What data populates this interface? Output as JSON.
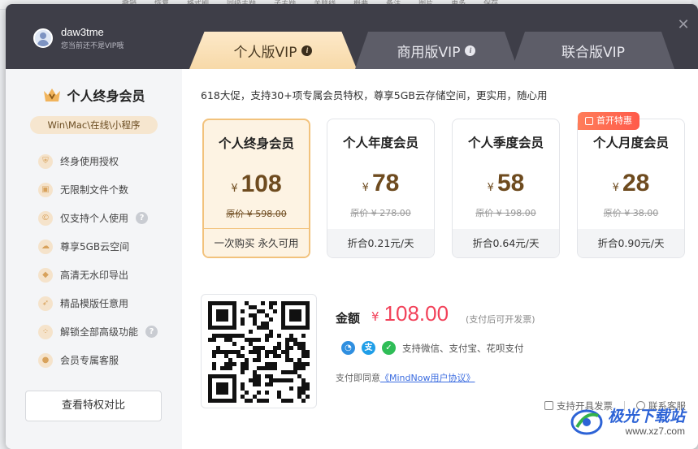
{
  "background": {
    "menu_items": [
      "撤销",
      "恢复",
      "格式刷",
      "同级主题",
      "子主题",
      "关联线",
      "概要",
      "备注",
      "图片",
      "更多",
      "保存"
    ]
  },
  "user": {
    "name": "daw3tme",
    "status": "您当前还不是VIP哦"
  },
  "tabs": [
    {
      "label": "个人版VIP"
    },
    {
      "label": "商用版VIP"
    },
    {
      "label": "联合版VIP"
    }
  ],
  "sidebar": {
    "title": "个人终身会员",
    "platforms": "Win\\Mac\\在线\\小程序",
    "features": [
      {
        "label": "终身使用授权",
        "icon": "shield-icon"
      },
      {
        "label": "无限制文件个数",
        "icon": "lock-icon"
      },
      {
        "label": "仅支持个人使用",
        "icon": "copyright-icon",
        "help": true
      },
      {
        "label": "尊享5GB云空间",
        "icon": "cloud-icon"
      },
      {
        "label": "高清无水印导出",
        "icon": "drop-icon"
      },
      {
        "label": "精品模版任意用",
        "icon": "rocket-icon"
      },
      {
        "label": "解锁全部高级功能",
        "icon": "grid-icon",
        "help": true
      },
      {
        "label": "会员专属客服",
        "icon": "user-icon"
      }
    ],
    "compare_button": "查看特权对比"
  },
  "promo": "618大促，支持30+项专属会员特权，尊享5GB云存储空间，更实用，随心用",
  "plans": [
    {
      "name": "个人终身会员",
      "currency": "¥",
      "price": "108",
      "original": "原价 ¥ 598.00",
      "footer": "一次购买 永久可用",
      "selected": true
    },
    {
      "name": "个人年度会员",
      "currency": "¥",
      "price": "78",
      "original": "原价 ¥ 278.00",
      "footer": "折合0.21元/天",
      "selected": false
    },
    {
      "name": "个人季度会员",
      "currency": "¥",
      "price": "58",
      "original": "原价 ¥ 198.00",
      "footer": "折合0.64元/天",
      "selected": false
    },
    {
      "name": "个人月度会员",
      "currency": "¥",
      "price": "28",
      "original": "原价 ¥ 38.00",
      "footer": "折合0.90元/天",
      "selected": false
    }
  ],
  "ribbon": "首开特惠",
  "payment": {
    "label": "金额",
    "currency": "¥",
    "amount": "108.00",
    "note": "(支付后可开发票)",
    "methods_text": "支持微信、支付宝、花呗支付",
    "agree_prefix": "支付即同意",
    "agree_link": "《MindNow用户协议》"
  },
  "footer": {
    "invoice": "支持开具发票",
    "service": "联系客服"
  },
  "watermark": {
    "name": "极光下载站",
    "url": "www.xz7.com"
  },
  "colors": {
    "accent": "#f2425a",
    "gold": "#f2c27c",
    "header": "#3e3e48",
    "link": "#3b6ce0"
  }
}
